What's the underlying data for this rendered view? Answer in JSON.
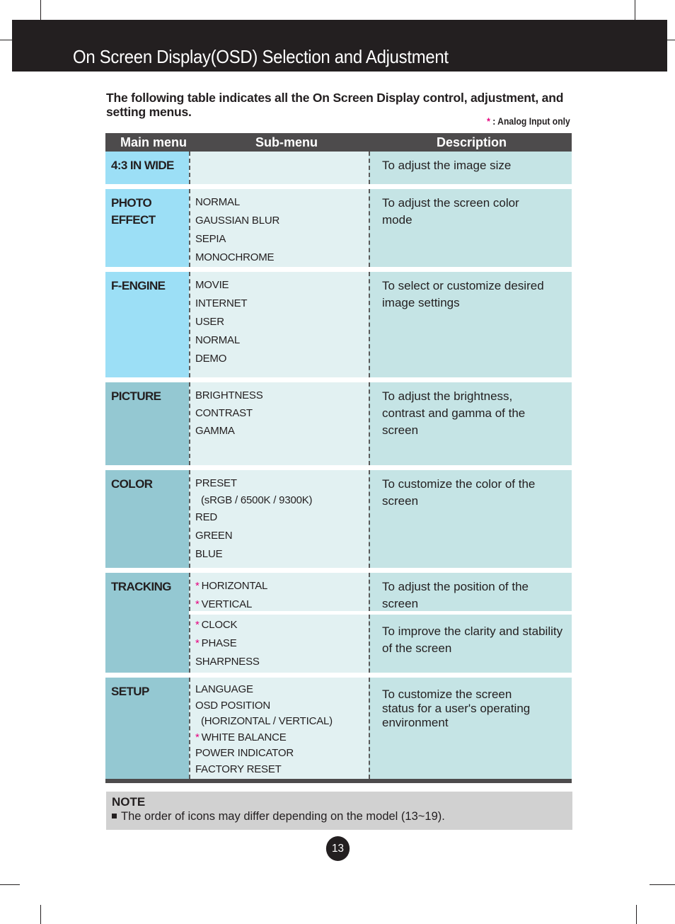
{
  "page": {
    "title": "On Screen Display(OSD) Selection and Adjustment",
    "intro": "The following table indicates all the On Screen Display control, adjustment, and setting menus.",
    "legend": {
      "symbol": "*",
      "text": ": Analog Input only"
    },
    "page_number": "13",
    "colors": {
      "title_bar": "#231f20",
      "header_row": "#4d4b4c",
      "main_light": "#9cdff6",
      "main_dark": "#94c8d2",
      "sub_bg": "#e2f1f2",
      "desc_bg": "#c5e4e5",
      "analog_marker": "#e6007e",
      "note_bg": "#d1d1d1"
    }
  },
  "table": {
    "headers": [
      "Main menu",
      "Sub-menu",
      "Description"
    ],
    "rows": [
      {
        "main": "4:3 IN WIDE",
        "groups": [
          {
            "items": [],
            "description": "To adjust the image size"
          }
        ]
      },
      {
        "main": "PHOTO EFFECT",
        "groups": [
          {
            "items": [
              {
                "label": "NORMAL",
                "analog": false
              },
              {
                "label": "GAUSSIAN BLUR",
                "analog": false
              },
              {
                "label": "SEPIA",
                "analog": false
              },
              {
                "label": "MONOCHROME",
                "analog": false
              }
            ],
            "description": "To adjust the screen color mode"
          }
        ]
      },
      {
        "main": "F-ENGINE",
        "groups": [
          {
            "items": [
              {
                "label": "MOVIE",
                "analog": false
              },
              {
                "label": "INTERNET",
                "analog": false
              },
              {
                "label": "USER",
                "analog": false
              },
              {
                "label": "NORMAL",
                "analog": false
              },
              {
                "label": "DEMO",
                "analog": false
              }
            ],
            "description": "To select or customize desired image settings"
          }
        ]
      },
      {
        "main": "PICTURE",
        "groups": [
          {
            "items": [
              {
                "label": "BRIGHTNESS",
                "analog": false
              },
              {
                "label": "CONTRAST",
                "analog": false
              },
              {
                "label": "GAMMA",
                "analog": false
              }
            ],
            "description": "To adjust the brightness, contrast and gamma of the screen"
          }
        ]
      },
      {
        "main": "COLOR",
        "groups": [
          {
            "items": [
              {
                "label": "PRESET",
                "analog": false
              },
              {
                "label": "(sRGB / 6500K / 9300K)",
                "analog": false,
                "indent": true
              },
              {
                "label": "RED",
                "analog": false
              },
              {
                "label": "GREEN",
                "analog": false
              },
              {
                "label": "BLUE",
                "analog": false
              }
            ],
            "description": "To customize the color of the screen"
          }
        ]
      },
      {
        "main": "TRACKING",
        "groups": [
          {
            "items": [
              {
                "label": "HORIZONTAL",
                "analog": true
              },
              {
                "label": "VERTICAL",
                "analog": true
              }
            ],
            "description": "To adjust the position of the screen"
          },
          {
            "items": [
              {
                "label": "CLOCK",
                "analog": true
              },
              {
                "label": "PHASE",
                "analog": true
              },
              {
                "label": "SHARPNESS",
                "analog": false
              }
            ],
            "description": "To improve the clarity and stability of the screen"
          }
        ]
      },
      {
        "main": "SETUP",
        "groups": [
          {
            "items": [
              {
                "label": "LANGUAGE",
                "analog": false
              },
              {
                "label": "OSD POSITION",
                "analog": false
              },
              {
                "label": "(HORIZONTAL / VERTICAL)",
                "analog": false,
                "indent": true
              },
              {
                "label": "WHITE BALANCE",
                "analog": true
              },
              {
                "label": "POWER INDICATOR",
                "analog": false
              },
              {
                "label": "FACTORY RESET",
                "analog": false
              }
            ],
            "description": "To customize the screen status for a user's operating environment"
          }
        ]
      }
    ]
  },
  "note": {
    "title": "NOTE",
    "body": "The order of icons may differ depending on the model (13~19)."
  }
}
